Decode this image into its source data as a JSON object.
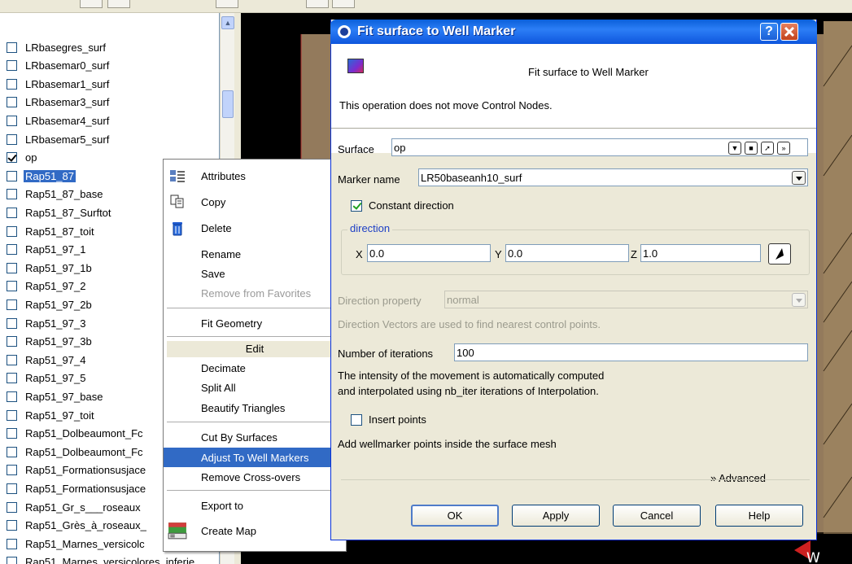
{
  "tree": {
    "items": [
      {
        "label": "LRbasegres_surf",
        "checked": false
      },
      {
        "label": "LRbasemar0_surf",
        "checked": false
      },
      {
        "label": "LRbasemar1_surf",
        "checked": false
      },
      {
        "label": "LRbasemar3_surf",
        "checked": false
      },
      {
        "label": "LRbasemar4_surf",
        "checked": false
      },
      {
        "label": "LRbasemar5_surf",
        "checked": false
      },
      {
        "label": "op",
        "checked": true
      },
      {
        "label": "Rap51_87",
        "checked": false,
        "selected": true
      },
      {
        "label": "Rap51_87_base",
        "checked": false
      },
      {
        "label": "Rap51_87_Surftot",
        "checked": false
      },
      {
        "label": "Rap51_87_toit",
        "checked": false
      },
      {
        "label": "Rap51_97_1",
        "checked": false
      },
      {
        "label": "Rap51_97_1b",
        "checked": false
      },
      {
        "label": "Rap51_97_2",
        "checked": false
      },
      {
        "label": "Rap51_97_2b",
        "checked": false
      },
      {
        "label": "Rap51_97_3",
        "checked": false
      },
      {
        "label": "Rap51_97_3b",
        "checked": false
      },
      {
        "label": "Rap51_97_4",
        "checked": false
      },
      {
        "label": "Rap51_97_5",
        "checked": false
      },
      {
        "label": "Rap51_97_base",
        "checked": false
      },
      {
        "label": "Rap51_97_toit",
        "checked": false
      },
      {
        "label": "Rap51_Dolbeaumont_Fc",
        "checked": false
      },
      {
        "label": "Rap51_Dolbeaumont_Fc",
        "checked": false
      },
      {
        "label": "Rap51_Formationsusjace",
        "checked": false
      },
      {
        "label": "Rap51_Formationsusjace",
        "checked": false
      },
      {
        "label": "Rap51_Gr_s___roseaux",
        "checked": false
      },
      {
        "label": "Rap51_Grès_à_roseaux_",
        "checked": false
      },
      {
        "label": "Rap51_Marnes_versicolc",
        "checked": false
      },
      {
        "label": "Rap51_Marnes_versicolores_inferie",
        "checked": false
      }
    ]
  },
  "context_menu": {
    "items": [
      {
        "label": "Attributes",
        "icon": "attributes-icon"
      },
      {
        "label": "Copy",
        "icon": "copy-icon"
      },
      {
        "label": "Delete",
        "icon": "trash-icon"
      },
      {
        "label": "Rename"
      },
      {
        "label": "Save"
      },
      {
        "label": "Remove from Favorites",
        "disabled": true
      },
      {
        "label": "Fit Geometry"
      },
      {
        "label": "Edit",
        "header": true
      },
      {
        "label": "Decimate"
      },
      {
        "label": "Split All"
      },
      {
        "label": "Beautify Triangles"
      },
      {
        "label": "Cut By Surfaces"
      },
      {
        "label": "Adjust To Well Markers",
        "highlighted": true
      },
      {
        "label": "Remove Cross-overs"
      },
      {
        "label": "Export to",
        "submenu": true
      },
      {
        "label": "Create Map",
        "icon": "map-icon"
      }
    ]
  },
  "dialog": {
    "title": "Fit surface to Well Marker",
    "help_button": "?",
    "header_title": "Fit surface to Well Marker",
    "note": "This operation does not move Control Nodes.",
    "surface_label": "Surface",
    "surface_value": "op",
    "marker_label": "Marker name",
    "marker_value": "LR50baseanh10_surf",
    "constant_direction_label": "Constant direction",
    "constant_direction_checked": true,
    "direction_group_title": "direction",
    "x_label": "X",
    "x_value": "0.0",
    "y_label": "Y",
    "y_value": "0.0",
    "z_label": "Z",
    "z_value": "1.0",
    "direction_property_label": "Direction property",
    "direction_property_value": "normal",
    "direction_vectors_note": "Direction Vectors are used to find nearest control points.",
    "iterations_label": "Number of iterations",
    "iterations_value": "100",
    "intensity_note_1": "The intensity of the movement is automatically computed",
    "intensity_note_2": "and interpolated using nb_iter iterations of Interpolation.",
    "insert_points_label": "Insert points",
    "insert_points_checked": false,
    "add_points_note": "Add wellmarker points inside the surface mesh",
    "advanced_label": "Advanced",
    "buttons": {
      "ok": "OK",
      "apply": "Apply",
      "cancel": "Cancel",
      "help": "Help"
    }
  },
  "viewport": {
    "axis_label": "W",
    "background_color": "#000000",
    "surface_color": "#937a5c"
  }
}
